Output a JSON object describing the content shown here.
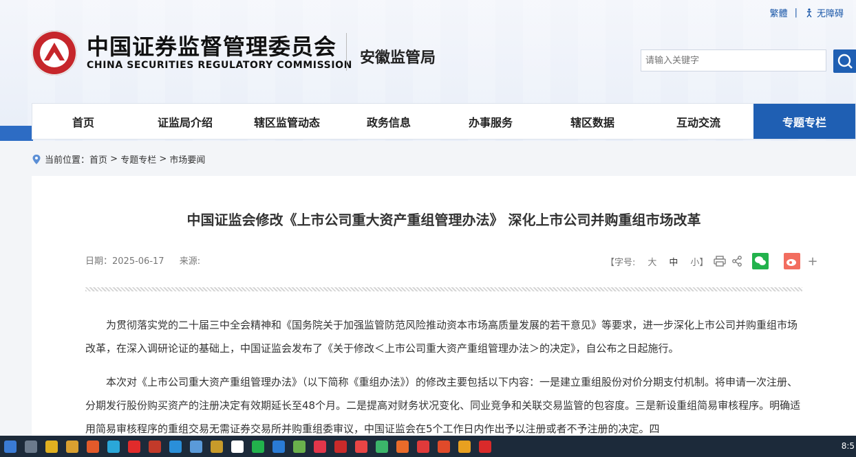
{
  "toplinks": {
    "traditional": "繁體",
    "separator": "|",
    "accessibility": "无障碍"
  },
  "logo": {
    "cn": "中国证券监督管理委员会",
    "en": "CHINA SECURITIES REGULATORY COMMISSION"
  },
  "bureau": "安徽监管局",
  "search": {
    "placeholder": "请输入关键字"
  },
  "nav": [
    {
      "label": "首页",
      "active": false
    },
    {
      "label": "证监局介绍",
      "active": false
    },
    {
      "label": "辖区监管动态",
      "active": false
    },
    {
      "label": "政务信息",
      "active": false
    },
    {
      "label": "办事服务",
      "active": false
    },
    {
      "label": "辖区数据",
      "active": false
    },
    {
      "label": "互动交流",
      "active": false
    },
    {
      "label": "专题专栏",
      "active": true
    }
  ],
  "breadcrumb": {
    "prefix": "当前位置：",
    "items": [
      "首页",
      "专题专栏",
      "市场要闻"
    ],
    "sep": " > "
  },
  "article": {
    "title": "中国证监会修改《上市公司重大资产重组管理办法》 深化上市公司并购重组市场改革",
    "date_label": "日期：2025-06-17",
    "source_label": "来源:",
    "font_label": "【字号:",
    "font_large": "大",
    "font_medium": "中",
    "font_small": "小】",
    "p1": "为贯彻落实党的二十届三中全会精神和《国务院关于加强监管防范风险推动资本市场高质量发展的若干意见》等要求，进一步深化上市公司并购重组市场改革，在深入调研论证的基础上，中国证监会发布了《关于修改＜上市公司重大资产重组管理办法＞的决定》，自公布之日起施行。",
    "p2": "本次对《上市公司重大资产重组管理办法》（以下简称《重组办法》）的修改主要包括以下内容：一是建立重组股份对价分期支付机制。将申请一次注册、分期发行股份购买资产的注册决定有效期延长至48个月。二是提高对财务状况变化、同业竞争和关联交易监管的包容度。三是新设重组简易审核程序。明确适用简易审核程序的重组交易无需证券交易所并购重组委审议，中国证监会在5个工作日内作出予以注册或者不予注册的决定。四"
  },
  "taskbar": {
    "clock": "8:5"
  },
  "colors": {
    "primary": "#1f5fb3",
    "emblem": "#c6262b",
    "wechat": "#22b24c",
    "weibo": "#f26d5f"
  }
}
